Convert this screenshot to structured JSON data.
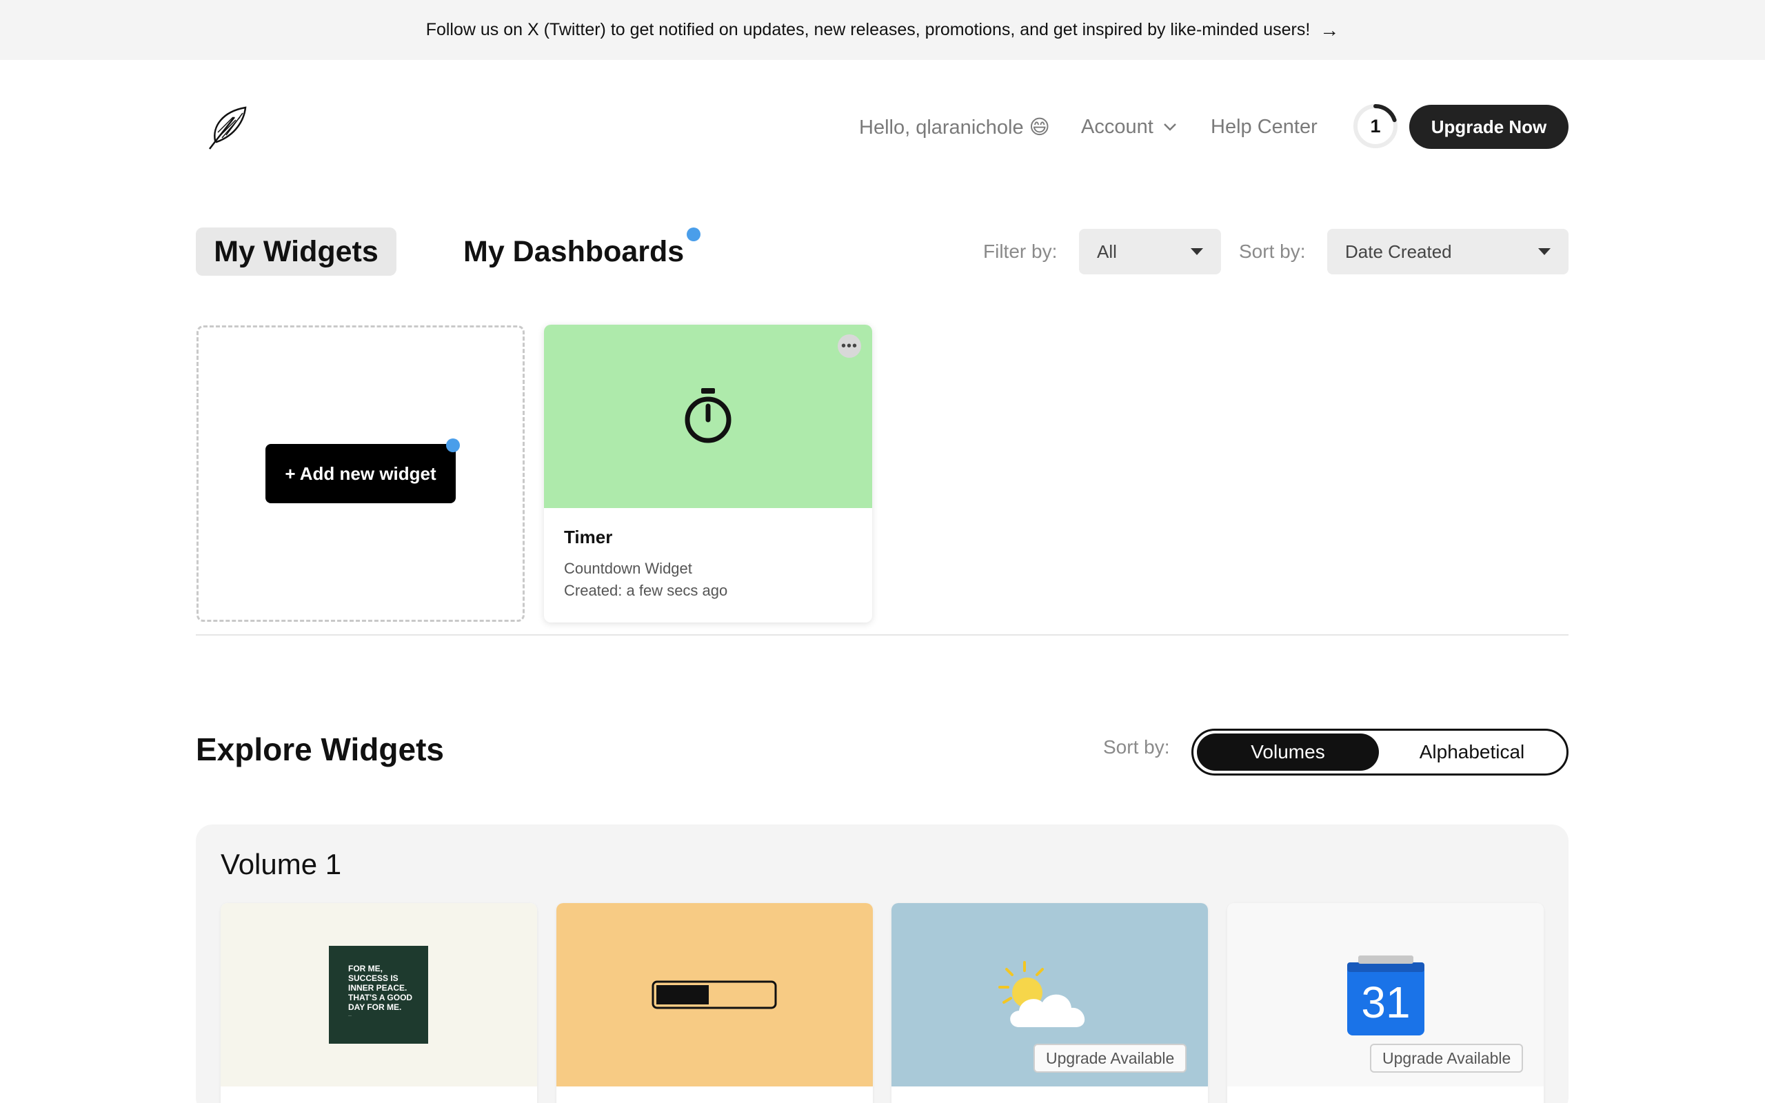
{
  "banner": {
    "text": "Follow us on X (Twitter) to get notified on updates, new releases, promotions, and get inspired by like-minded users!",
    "arrow": "→"
  },
  "header": {
    "logo_icon": "feather-icon",
    "greeting": "Hello, qlaranichole 😄",
    "account": "Account",
    "help": "Help Center",
    "credits": "1",
    "credits_progress": 0.2,
    "upgrade": "Upgrade Now"
  },
  "tabs": {
    "widgets": "My Widgets",
    "dashboards": "My Dashboards"
  },
  "filters": {
    "filter_label": "Filter by:",
    "filter_value": "All",
    "sort_label": "Sort by:",
    "sort_value": "Date Created"
  },
  "my_widgets": {
    "add_button": "+ Add new widget",
    "cards": [
      {
        "title": "Timer",
        "subtitle": "Countdown Widget",
        "created": "Created: a few secs ago",
        "icon": "stopwatch-icon",
        "color": "#aeeaab",
        "menu": "•••"
      }
    ]
  },
  "explore": {
    "title": "Explore Widgets",
    "sort_label": "Sort by:",
    "sort_options": [
      "Volumes",
      "Alphabetical"
    ],
    "selected_sort": "Volumes"
  },
  "volume": {
    "title": "Volume 1",
    "cards": [
      {
        "color": "#f6f5ec",
        "thumb": "quote-icon",
        "quote": "FOR ME, SUCCESS IS INNER PEACE. THAT'S A GOOD DAY FOR ME.",
        "badge": ""
      },
      {
        "color": "#f7cb84",
        "thumb": "progress-bar-icon",
        "progress": 0.45,
        "badge": ""
      },
      {
        "color": "#a9c9d8",
        "thumb": "partly-cloudy-icon",
        "badge": "Upgrade Available"
      },
      {
        "color": "#f8f8f8",
        "thumb": "calendar-icon",
        "calendar_day": "31",
        "badge": "Upgrade Available"
      }
    ]
  },
  "colors": {
    "accent_dot": "#4a9eea",
    "dark_button": "#222222",
    "banner_bg": "#f4f4f4"
  }
}
